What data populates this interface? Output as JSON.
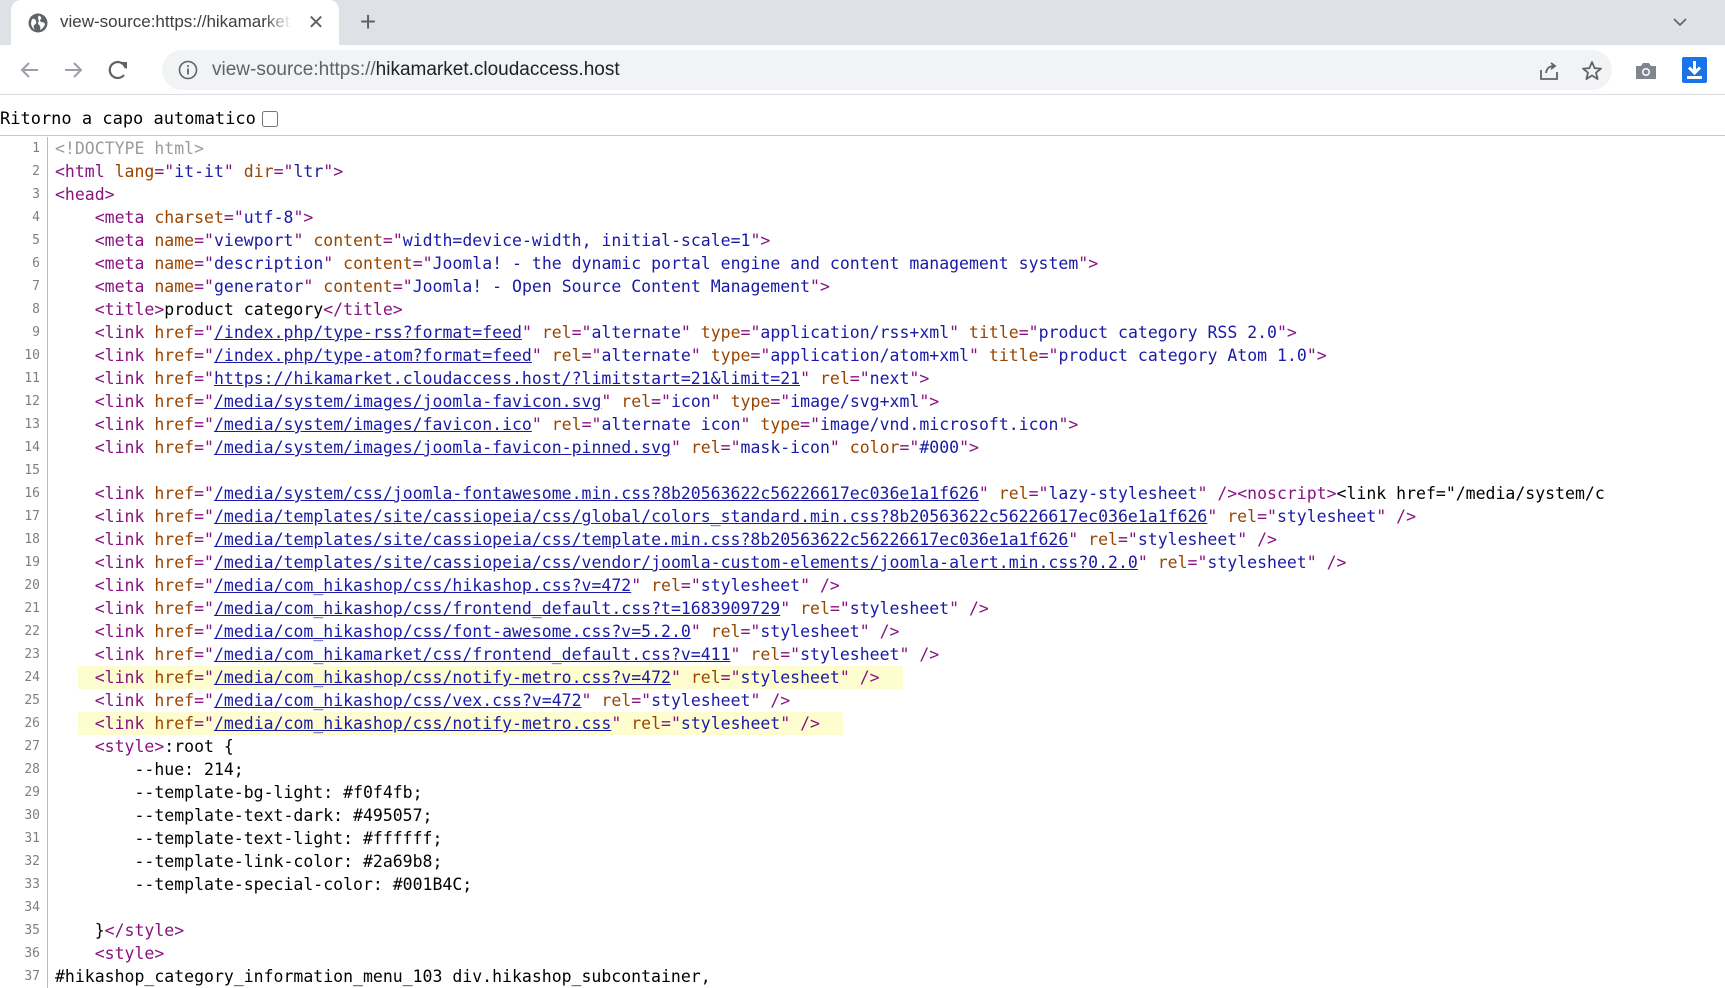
{
  "tab": {
    "title": "view-source:https://hikamarket.cloudaccess.host",
    "close_glyph": "✕",
    "newtab_glyph": "+"
  },
  "address": {
    "scheme": "view-source:https://",
    "host": "hikamarket.cloudaccess.host"
  },
  "page": {
    "wrap_label": "Ritorno a capo automatico",
    "wrap_checked": false
  },
  "icons": {
    "tab": "globe-icon",
    "back": "arrow-left-icon",
    "forward": "arrow-right-icon",
    "reload": "reload-icon",
    "info": "info-icon",
    "share": "share-icon",
    "bookmark": "star-icon",
    "screenshot": "camera-icon",
    "download": "download-icon",
    "tabmenu": "chevron-down-icon"
  },
  "colors": {
    "tag": "#881280",
    "attr": "#994500",
    "value": "#1a1aa6",
    "comment": "#9b9b9b",
    "highlight": "#fdfdd0",
    "download": "#1a73e8"
  },
  "source_lines": [
    {
      "n": 1,
      "parts": [
        [
          "c",
          "<!DOCTYPE html>"
        ]
      ]
    },
    {
      "n": 2,
      "parts": [
        [
          "t",
          "<html "
        ],
        [
          "a",
          "lang"
        ],
        [
          "t",
          "=\""
        ],
        [
          "v",
          "it-it"
        ],
        [
          "t",
          "\" "
        ],
        [
          "a",
          "dir"
        ],
        [
          "t",
          "=\""
        ],
        [
          "v",
          "ltr"
        ],
        [
          "t",
          "\">"
        ]
      ]
    },
    {
      "n": 3,
      "parts": [
        [
          "t",
          "<head>"
        ]
      ]
    },
    {
      "n": 4,
      "parts": [
        [
          "x",
          "    "
        ],
        [
          "t",
          "<meta "
        ],
        [
          "a",
          "charset"
        ],
        [
          "t",
          "=\""
        ],
        [
          "v",
          "utf-8"
        ],
        [
          "t",
          "\">"
        ]
      ]
    },
    {
      "n": 5,
      "parts": [
        [
          "x",
          "    "
        ],
        [
          "t",
          "<meta "
        ],
        [
          "a",
          "name"
        ],
        [
          "t",
          "=\""
        ],
        [
          "v",
          "viewport"
        ],
        [
          "t",
          "\" "
        ],
        [
          "a",
          "content"
        ],
        [
          "t",
          "=\""
        ],
        [
          "v",
          "width=device-width, initial-scale=1"
        ],
        [
          "t",
          "\">"
        ]
      ]
    },
    {
      "n": 6,
      "parts": [
        [
          "x",
          "    "
        ],
        [
          "t",
          "<meta "
        ],
        [
          "a",
          "name"
        ],
        [
          "t",
          "=\""
        ],
        [
          "v",
          "description"
        ],
        [
          "t",
          "\" "
        ],
        [
          "a",
          "content"
        ],
        [
          "t",
          "=\""
        ],
        [
          "v",
          "Joomla! - the dynamic portal engine and content management system"
        ],
        [
          "t",
          "\">"
        ]
      ]
    },
    {
      "n": 7,
      "parts": [
        [
          "x",
          "    "
        ],
        [
          "t",
          "<meta "
        ],
        [
          "a",
          "name"
        ],
        [
          "t",
          "=\""
        ],
        [
          "v",
          "generator"
        ],
        [
          "t",
          "\" "
        ],
        [
          "a",
          "content"
        ],
        [
          "t",
          "=\""
        ],
        [
          "v",
          "Joomla! - Open Source Content Management"
        ],
        [
          "t",
          "\">"
        ]
      ]
    },
    {
      "n": 8,
      "parts": [
        [
          "x",
          "    "
        ],
        [
          "t",
          "<title>"
        ],
        [
          "x",
          "product category"
        ],
        [
          "t",
          "</title>"
        ]
      ]
    },
    {
      "n": 9,
      "parts": [
        [
          "x",
          "    "
        ],
        [
          "t",
          "<link "
        ],
        [
          "a",
          "href"
        ],
        [
          "t",
          "=\""
        ],
        [
          "l",
          "/index.php/type-rss?format=feed"
        ],
        [
          "t",
          "\" "
        ],
        [
          "a",
          "rel"
        ],
        [
          "t",
          "=\""
        ],
        [
          "v",
          "alternate"
        ],
        [
          "t",
          "\" "
        ],
        [
          "a",
          "type"
        ],
        [
          "t",
          "=\""
        ],
        [
          "v",
          "application/rss+xml"
        ],
        [
          "t",
          "\" "
        ],
        [
          "a",
          "title"
        ],
        [
          "t",
          "=\""
        ],
        [
          "v",
          "product category RSS 2.0"
        ],
        [
          "t",
          "\">"
        ]
      ]
    },
    {
      "n": 10,
      "parts": [
        [
          "x",
          "    "
        ],
        [
          "t",
          "<link "
        ],
        [
          "a",
          "href"
        ],
        [
          "t",
          "=\""
        ],
        [
          "l",
          "/index.php/type-atom?format=feed"
        ],
        [
          "t",
          "\" "
        ],
        [
          "a",
          "rel"
        ],
        [
          "t",
          "=\""
        ],
        [
          "v",
          "alternate"
        ],
        [
          "t",
          "\" "
        ],
        [
          "a",
          "type"
        ],
        [
          "t",
          "=\""
        ],
        [
          "v",
          "application/atom+xml"
        ],
        [
          "t",
          "\" "
        ],
        [
          "a",
          "title"
        ],
        [
          "t",
          "=\""
        ],
        [
          "v",
          "product category Atom 1.0"
        ],
        [
          "t",
          "\">"
        ]
      ]
    },
    {
      "n": 11,
      "parts": [
        [
          "x",
          "    "
        ],
        [
          "t",
          "<link "
        ],
        [
          "a",
          "href"
        ],
        [
          "t",
          "=\""
        ],
        [
          "l",
          "https://hikamarket.cloudaccess.host/?limitstart=21&limit=21"
        ],
        [
          "t",
          "\" "
        ],
        [
          "a",
          "rel"
        ],
        [
          "t",
          "=\""
        ],
        [
          "v",
          "next"
        ],
        [
          "t",
          "\">"
        ]
      ]
    },
    {
      "n": 12,
      "parts": [
        [
          "x",
          "    "
        ],
        [
          "t",
          "<link "
        ],
        [
          "a",
          "href"
        ],
        [
          "t",
          "=\""
        ],
        [
          "l",
          "/media/system/images/joomla-favicon.svg"
        ],
        [
          "t",
          "\" "
        ],
        [
          "a",
          "rel"
        ],
        [
          "t",
          "=\""
        ],
        [
          "v",
          "icon"
        ],
        [
          "t",
          "\" "
        ],
        [
          "a",
          "type"
        ],
        [
          "t",
          "=\""
        ],
        [
          "v",
          "image/svg+xml"
        ],
        [
          "t",
          "\">"
        ]
      ]
    },
    {
      "n": 13,
      "parts": [
        [
          "x",
          "    "
        ],
        [
          "t",
          "<link "
        ],
        [
          "a",
          "href"
        ],
        [
          "t",
          "=\""
        ],
        [
          "l",
          "/media/system/images/favicon.ico"
        ],
        [
          "t",
          "\" "
        ],
        [
          "a",
          "rel"
        ],
        [
          "t",
          "=\""
        ],
        [
          "v",
          "alternate icon"
        ],
        [
          "t",
          "\" "
        ],
        [
          "a",
          "type"
        ],
        [
          "t",
          "=\""
        ],
        [
          "v",
          "image/vnd.microsoft.icon"
        ],
        [
          "t",
          "\">"
        ]
      ]
    },
    {
      "n": 14,
      "parts": [
        [
          "x",
          "    "
        ],
        [
          "t",
          "<link "
        ],
        [
          "a",
          "href"
        ],
        [
          "t",
          "=\""
        ],
        [
          "l",
          "/media/system/images/joomla-favicon-pinned.svg"
        ],
        [
          "t",
          "\" "
        ],
        [
          "a",
          "rel"
        ],
        [
          "t",
          "=\""
        ],
        [
          "v",
          "mask-icon"
        ],
        [
          "t",
          "\" "
        ],
        [
          "a",
          "color"
        ],
        [
          "t",
          "=\""
        ],
        [
          "v",
          "#000"
        ],
        [
          "t",
          "\">"
        ]
      ]
    },
    {
      "n": 15,
      "parts": []
    },
    {
      "n": 16,
      "parts": [
        [
          "x",
          "    "
        ],
        [
          "t",
          "<link "
        ],
        [
          "a",
          "href"
        ],
        [
          "t",
          "=\""
        ],
        [
          "l",
          "/media/system/css/joomla-fontawesome.min.css?8b20563622c56226617ec036e1a1f626"
        ],
        [
          "t",
          "\" "
        ],
        [
          "a",
          "rel"
        ],
        [
          "t",
          "=\""
        ],
        [
          "v",
          "lazy-stylesheet"
        ],
        [
          "t",
          "\" /><noscript>"
        ],
        [
          "x",
          "<link href=\"/media/system/c"
        ]
      ]
    },
    {
      "n": 17,
      "parts": [
        [
          "x",
          "    "
        ],
        [
          "t",
          "<link "
        ],
        [
          "a",
          "href"
        ],
        [
          "t",
          "=\""
        ],
        [
          "l",
          "/media/templates/site/cassiopeia/css/global/colors_standard.min.css?8b20563622c56226617ec036e1a1f626"
        ],
        [
          "t",
          "\" "
        ],
        [
          "a",
          "rel"
        ],
        [
          "t",
          "=\""
        ],
        [
          "v",
          "stylesheet"
        ],
        [
          "t",
          "\" />"
        ]
      ]
    },
    {
      "n": 18,
      "parts": [
        [
          "x",
          "    "
        ],
        [
          "t",
          "<link "
        ],
        [
          "a",
          "href"
        ],
        [
          "t",
          "=\""
        ],
        [
          "l",
          "/media/templates/site/cassiopeia/css/template.min.css?8b20563622c56226617ec036e1a1f626"
        ],
        [
          "t",
          "\" "
        ],
        [
          "a",
          "rel"
        ],
        [
          "t",
          "=\""
        ],
        [
          "v",
          "stylesheet"
        ],
        [
          "t",
          "\" />"
        ]
      ]
    },
    {
      "n": 19,
      "parts": [
        [
          "x",
          "    "
        ],
        [
          "t",
          "<link "
        ],
        [
          "a",
          "href"
        ],
        [
          "t",
          "=\""
        ],
        [
          "l",
          "/media/templates/site/cassiopeia/css/vendor/joomla-custom-elements/joomla-alert.min.css?0.2.0"
        ],
        [
          "t",
          "\" "
        ],
        [
          "a",
          "rel"
        ],
        [
          "t",
          "=\""
        ],
        [
          "v",
          "stylesheet"
        ],
        [
          "t",
          "\" />"
        ]
      ]
    },
    {
      "n": 20,
      "parts": [
        [
          "x",
          "    "
        ],
        [
          "t",
          "<link "
        ],
        [
          "a",
          "href"
        ],
        [
          "t",
          "=\""
        ],
        [
          "l",
          "/media/com_hikashop/css/hikashop.css?v=472"
        ],
        [
          "t",
          "\" "
        ],
        [
          "a",
          "rel"
        ],
        [
          "t",
          "=\""
        ],
        [
          "v",
          "stylesheet"
        ],
        [
          "t",
          "\" />"
        ]
      ]
    },
    {
      "n": 21,
      "parts": [
        [
          "x",
          "    "
        ],
        [
          "t",
          "<link "
        ],
        [
          "a",
          "href"
        ],
        [
          "t",
          "=\""
        ],
        [
          "l",
          "/media/com_hikashop/css/frontend_default.css?t=1683909729"
        ],
        [
          "t",
          "\" "
        ],
        [
          "a",
          "rel"
        ],
        [
          "t",
          "=\""
        ],
        [
          "v",
          "stylesheet"
        ],
        [
          "t",
          "\" />"
        ]
      ]
    },
    {
      "n": 22,
      "parts": [
        [
          "x",
          "    "
        ],
        [
          "t",
          "<link "
        ],
        [
          "a",
          "href"
        ],
        [
          "t",
          "=\""
        ],
        [
          "l",
          "/media/com_hikashop/css/font-awesome.css?v=5.2.0"
        ],
        [
          "t",
          "\" "
        ],
        [
          "a",
          "rel"
        ],
        [
          "t",
          "=\""
        ],
        [
          "v",
          "stylesheet"
        ],
        [
          "t",
          "\" />"
        ]
      ]
    },
    {
      "n": 23,
      "parts": [
        [
          "x",
          "    "
        ],
        [
          "t",
          "<link "
        ],
        [
          "a",
          "href"
        ],
        [
          "t",
          "=\""
        ],
        [
          "l",
          "/media/com_hikamarket/css/frontend_default.css?v=411"
        ],
        [
          "t",
          "\" "
        ],
        [
          "a",
          "rel"
        ],
        [
          "t",
          "=\""
        ],
        [
          "v",
          "stylesheet"
        ],
        [
          "t",
          "\" />"
        ]
      ]
    },
    {
      "n": 24,
      "hl": true,
      "parts": [
        [
          "x",
          "    "
        ],
        [
          "t",
          "<link "
        ],
        [
          "a",
          "href"
        ],
        [
          "t",
          "=\""
        ],
        [
          "l",
          "/media/com_hikashop/css/notify-metro.css?v=472"
        ],
        [
          "t",
          "\" "
        ],
        [
          "a",
          "rel"
        ],
        [
          "t",
          "=\""
        ],
        [
          "v",
          "stylesheet"
        ],
        [
          "t",
          "\" />"
        ]
      ]
    },
    {
      "n": 25,
      "parts": [
        [
          "x",
          "    "
        ],
        [
          "t",
          "<link "
        ],
        [
          "a",
          "href"
        ],
        [
          "t",
          "=\""
        ],
        [
          "l",
          "/media/com_hikashop/css/vex.css?v=472"
        ],
        [
          "t",
          "\" "
        ],
        [
          "a",
          "rel"
        ],
        [
          "t",
          "=\""
        ],
        [
          "v",
          "stylesheet"
        ],
        [
          "t",
          "\" />"
        ]
      ]
    },
    {
      "n": 26,
      "hl": true,
      "parts": [
        [
          "x",
          "    "
        ],
        [
          "t",
          "<link "
        ],
        [
          "a",
          "href"
        ],
        [
          "t",
          "=\""
        ],
        [
          "l",
          "/media/com_hikashop/css/notify-metro.css"
        ],
        [
          "t",
          "\" "
        ],
        [
          "a",
          "rel"
        ],
        [
          "t",
          "=\""
        ],
        [
          "v",
          "stylesheet"
        ],
        [
          "t",
          "\" />"
        ]
      ]
    },
    {
      "n": 27,
      "parts": [
        [
          "x",
          "    "
        ],
        [
          "t",
          "<style>"
        ],
        [
          "x",
          ":root {"
        ]
      ]
    },
    {
      "n": 28,
      "parts": [
        [
          "x",
          "        --hue: 214;"
        ]
      ]
    },
    {
      "n": 29,
      "parts": [
        [
          "x",
          "        --template-bg-light: #f0f4fb;"
        ]
      ]
    },
    {
      "n": 30,
      "parts": [
        [
          "x",
          "        --template-text-dark: #495057;"
        ]
      ]
    },
    {
      "n": 31,
      "parts": [
        [
          "x",
          "        --template-text-light: #ffffff;"
        ]
      ]
    },
    {
      "n": 32,
      "parts": [
        [
          "x",
          "        --template-link-color: #2a69b8;"
        ]
      ]
    },
    {
      "n": 33,
      "parts": [
        [
          "x",
          "        --template-special-color: #001B4C;"
        ]
      ]
    },
    {
      "n": 34,
      "parts": []
    },
    {
      "n": 35,
      "parts": [
        [
          "x",
          "    }"
        ],
        [
          "t",
          "</style>"
        ]
      ]
    },
    {
      "n": 36,
      "parts": [
        [
          "x",
          "    "
        ],
        [
          "t",
          "<style>"
        ]
      ]
    },
    {
      "n": 37,
      "parts": [
        [
          "x",
          "#hikashop_category_information_menu_103 div.hikashop_subcontainer,"
        ]
      ]
    }
  ]
}
